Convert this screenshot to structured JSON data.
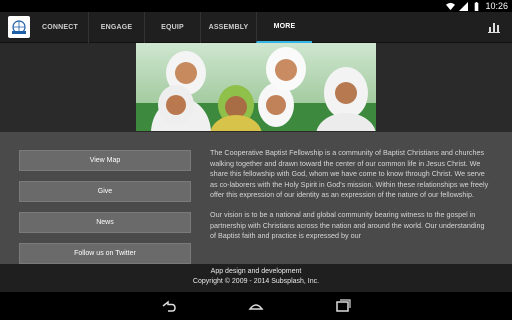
{
  "status": {
    "time": "10:26"
  },
  "app": {
    "tabs": [
      {
        "label": "CONNECT"
      },
      {
        "label": "ENGAGE"
      },
      {
        "label": "EQUIP"
      },
      {
        "label": "ASSEMBLY"
      },
      {
        "label": "MORE"
      }
    ],
    "active_tab": "MORE",
    "accent_color": "#33b5e5"
  },
  "menu": {
    "buttons": [
      {
        "label": "View Map"
      },
      {
        "label": "Give"
      },
      {
        "label": "News"
      },
      {
        "label": "Follow us on Twitter"
      }
    ]
  },
  "about": {
    "paragraph1": "The Cooperative Baptist Fellowship is a community of Baptist Christians and churches walking together and drawn toward the center of our common life in Jesus Christ. We share this fellowship with God, whom we have come to know through Christ. We serve as co-laborers with the Holy Spirit in God's mission. Within these relationships we freely offer this expression of our identity as an expression of the nature of our fellowship.",
    "paragraph2": "Our vision is to be a national and global community bearing witness to the gospel in partnership with Christians across the nation and around the world. Our understanding of Baptist faith and practice is expressed by our"
  },
  "footer": {
    "line1": "App design and development",
    "line2": "Copyright © 2009 - 2014 Subsplash, Inc."
  }
}
